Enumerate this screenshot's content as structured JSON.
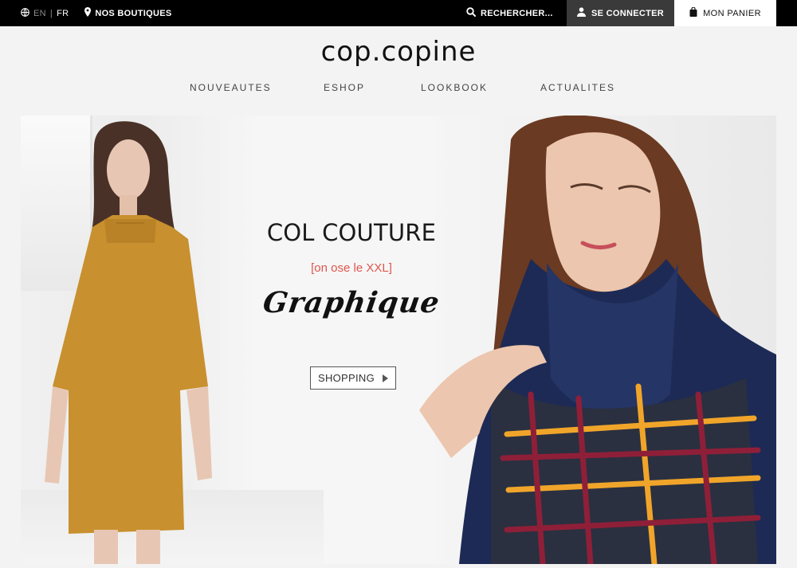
{
  "topbar": {
    "lang_en": "EN",
    "lang_sep": "|",
    "lang_fr": "FR",
    "boutiques": "NOS BOUTIQUES",
    "search": "RECHERCHER...",
    "login": "SE CONNECTER",
    "cart": "MON PANIER"
  },
  "brand": {
    "logo": "cop.copine"
  },
  "nav": [
    "NOUVEAUTES",
    "ESHOP",
    "LOOKBOOK",
    "ACTUALITES"
  ],
  "hero": {
    "title": "COL COUTURE",
    "subtitle": "[on ose le XXL]",
    "script": "Graphique",
    "cta": "SHOPPING"
  },
  "colors": {
    "topbar_bg": "#000000",
    "login_bg": "#3a3a3a",
    "accent_red": "#e0554e",
    "mustard_dress": "#c8902e",
    "navy_sweater": "#1d2a55"
  },
  "icons": {
    "globe": "globe-icon",
    "pin": "map-pin-icon",
    "search": "search-icon",
    "user": "user-icon",
    "bag": "shopping-bag-icon",
    "play": "play-arrow-icon"
  }
}
